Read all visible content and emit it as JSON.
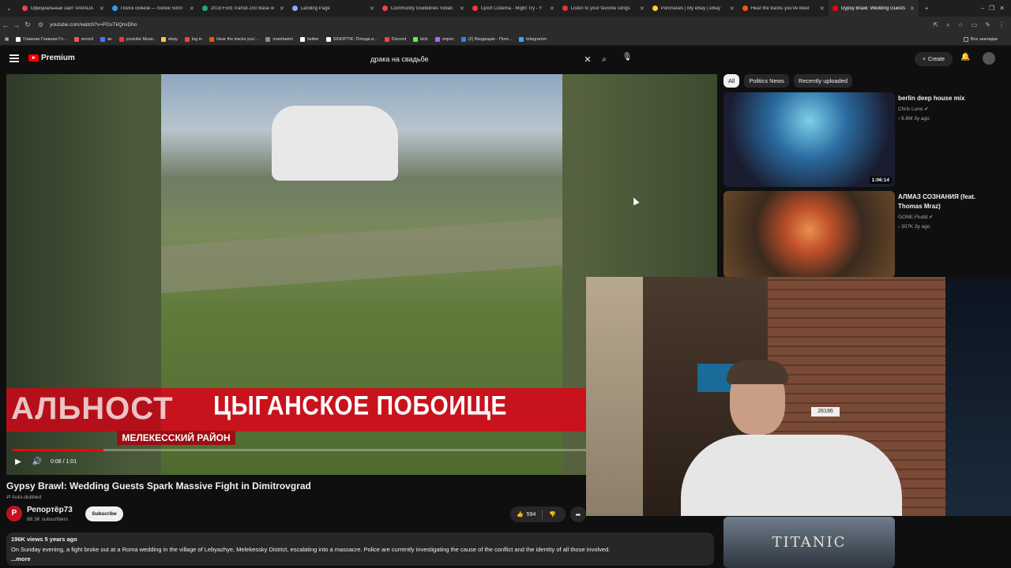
{
  "browser": {
    "tabs": [
      {
        "label": "Официальный сайт VAVADA",
        "color": "#e44"
      },
      {
        "label": "Поиск скинов — более 5000",
        "color": "#39f"
      },
      {
        "label": "2018 Ford Transit-150 Base w",
        "color": "#2a7"
      },
      {
        "label": "Landing Page",
        "color": "#8af"
      },
      {
        "label": "Community Guidelines Violati",
        "color": "#e44"
      },
      {
        "label": "Cport Cistema - Might Try - Y",
        "color": "#f33"
      },
      {
        "label": "Listen to your favorite songs",
        "color": "#e33"
      },
      {
        "label": "Purchases | My eBay | eBay",
        "color": "#fc3"
      },
      {
        "label": "Hear the tracks you've liked",
        "color": "#f50"
      },
      {
        "label": "Gypsy Brawl: Wedding Guests",
        "color": "#f00",
        "active": true
      }
    ],
    "url": "youtube.com/watch?v=PGsTkQnvDho",
    "bookmarks": [
      {
        "label": "Главная Главная Гл...",
        "color": "#fff"
      },
      {
        "label": "record",
        "color": "#e55"
      },
      {
        "label": "вк",
        "color": "#47f"
      },
      {
        "label": "youtube Music",
        "color": "#f33"
      },
      {
        "label": "ebay",
        "color": "#fc3"
      },
      {
        "label": "log in",
        "color": "#e44"
      },
      {
        "label": "Hear the tracks you'...",
        "color": "#f50"
      },
      {
        "label": "manhaeim",
        "color": "#88a"
      },
      {
        "label": "twitter",
        "color": "#fff"
      },
      {
        "label": "SINOPTIK: Погода в...",
        "color": "#fff"
      },
      {
        "label": "Discord",
        "color": "#e44"
      },
      {
        "label": "kick",
        "color": "#5f3"
      },
      {
        "label": "опрос",
        "color": "#a6f"
      },
      {
        "label": "(2) Входящие - Почт...",
        "color": "#47f"
      },
      {
        "label": "telegramm",
        "color": "#3af"
      }
    ],
    "bookmarks_all": "Все закладки"
  },
  "header": {
    "logo_text": "Premium",
    "search_query": "драка на свадьбе",
    "create_label": "Create"
  },
  "player": {
    "overlay_main": "ЦЫГАНСКОЕ ПОБОИЩЕ",
    "overlay_left": "АЛЬНОСТ",
    "overlay_sub": "МЕЛЕКЕССКИЙ РАЙОН",
    "time": "0:08 / 1:01",
    "progress": 0.13
  },
  "video": {
    "title": "Gypsy Brawl: Wedding Guests Spark Massive Fight in Dimitrovgrad",
    "auto_dubbed": "Auto-dubbed",
    "channel_name": "Репортёр73",
    "subscribers": "88.3K subscribers",
    "subscribe_label": "Subscribe",
    "likes": "594",
    "views_age": "196K views  5 years ago",
    "description": "On Sunday evening, a fight broke out at a Roma wedding in the village of Lebyazhye, Melekessky District, escalating into a massacre. Police are currently investigating the cause of the conflict and the identity of all those involved.",
    "more_label": "...more"
  },
  "sidebar": {
    "chips": [
      "All",
      "Politics News",
      "Recently uploaded"
    ],
    "recommendations": [
      {
        "title": "berlin deep house mix",
        "channel": "Chris Luno",
        "meta": "6.6M  3y ago",
        "duration": "1:06:14"
      },
      {
        "title": "АЛМАЗ СОЗНАНИЯ (feat. Thomas Mraz)",
        "channel": "GONE.Fludd",
        "meta": "307K  3y ago",
        "duration": ""
      }
    ],
    "bottom_thumb_text": "TITANIC"
  },
  "webcam": {
    "plate_text": "26186"
  }
}
